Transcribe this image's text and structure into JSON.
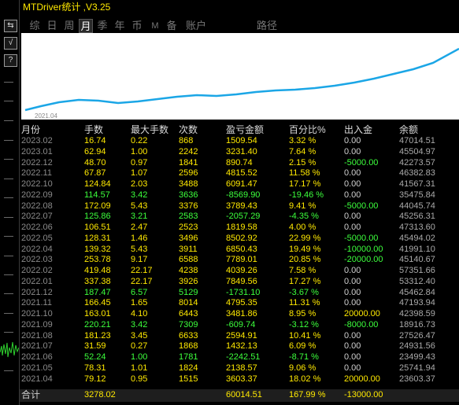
{
  "title": "MTDriver统计 ,V3.25",
  "tabs": [
    "综",
    "日",
    "周",
    "月",
    "季",
    "年",
    "币",
    "M",
    "备",
    "账户",
    "路径"
  ],
  "active_tab": "月",
  "toolbar": {
    "b1": "⇆",
    "b2": "√",
    "b3": "?"
  },
  "chart": {
    "date_label": "2021.04"
  },
  "headers": [
    "月份",
    "手数",
    "最大手数",
    "次数",
    "盈亏金额",
    "百分比%",
    "出入金",
    "余额"
  ],
  "rows": [
    {
      "c": [
        "2023.02",
        "16.74",
        "0.22",
        "868",
        "1509.54",
        "3.32 %",
        "0.00",
        "47014.51"
      ],
      "cls": [
        "dim",
        "y",
        "y",
        "y",
        "y",
        "y",
        "w",
        "m"
      ]
    },
    {
      "c": [
        "2023.01",
        "62.94",
        "1.00",
        "2242",
        "3231.40",
        "7.64 %",
        "0.00",
        "45504.97"
      ],
      "cls": [
        "dim",
        "y",
        "y",
        "y",
        "y",
        "y",
        "w",
        "m"
      ]
    },
    {
      "c": [
        "2022.12",
        "48.70",
        "0.97",
        "1841",
        "890.74",
        "2.15 %",
        "-5000.00",
        "42273.57"
      ],
      "cls": [
        "dim",
        "y",
        "y",
        "y",
        "y",
        "y",
        "g",
        "m"
      ]
    },
    {
      "c": [
        "2022.11",
        "67.87",
        "1.07",
        "2596",
        "4815.52",
        "11.58 %",
        "0.00",
        "46382.83"
      ],
      "cls": [
        "dim",
        "y",
        "y",
        "y",
        "y",
        "y",
        "w",
        "m"
      ]
    },
    {
      "c": [
        "2022.10",
        "124.84",
        "2.03",
        "3488",
        "6091.47",
        "17.17 %",
        "0.00",
        "41567.31"
      ],
      "cls": [
        "dim",
        "y",
        "y",
        "y",
        "y",
        "y",
        "w",
        "m"
      ]
    },
    {
      "c": [
        "2022.09",
        "114.57",
        "3.42",
        "3636",
        "-8569.90",
        "-19.46 %",
        "0.00",
        "35475.84"
      ],
      "cls": [
        "dim",
        "g",
        "g",
        "g",
        "g",
        "g",
        "w",
        "m"
      ]
    },
    {
      "c": [
        "2022.08",
        "172.09",
        "5.43",
        "3376",
        "3789.43",
        "9.41 %",
        "-5000.00",
        "44045.74"
      ],
      "cls": [
        "dim",
        "y",
        "y",
        "y",
        "y",
        "y",
        "g",
        "m"
      ]
    },
    {
      "c": [
        "2022.07",
        "125.86",
        "3.21",
        "2583",
        "-2057.29",
        "-4.35 %",
        "0.00",
        "45256.31"
      ],
      "cls": [
        "dim",
        "g",
        "g",
        "g",
        "g",
        "g",
        "w",
        "m"
      ]
    },
    {
      "c": [
        "2022.06",
        "106.51",
        "2.47",
        "2523",
        "1819.58",
        "4.00 %",
        "0.00",
        "47313.60"
      ],
      "cls": [
        "dim",
        "y",
        "y",
        "y",
        "y",
        "y",
        "w",
        "m"
      ]
    },
    {
      "c": [
        "2022.05",
        "128.31",
        "1.46",
        "3496",
        "8502.92",
        "22.99 %",
        "-5000.00",
        "45494.02"
      ],
      "cls": [
        "dim",
        "y",
        "y",
        "y",
        "y",
        "y",
        "g",
        "m"
      ]
    },
    {
      "c": [
        "2022.04",
        "139.32",
        "5.43",
        "3911",
        "6850.43",
        "19.49 %",
        "-10000.00",
        "41991.10"
      ],
      "cls": [
        "dim",
        "y",
        "y",
        "y",
        "y",
        "y",
        "g",
        "m"
      ]
    },
    {
      "c": [
        "2022.03",
        "253.78",
        "9.17",
        "6588",
        "7789.01",
        "20.85 %",
        "-20000.00",
        "45140.67"
      ],
      "cls": [
        "dim",
        "y",
        "y",
        "y",
        "y",
        "y",
        "g",
        "m"
      ]
    },
    {
      "c": [
        "2022.02",
        "419.48",
        "22.17",
        "4238",
        "4039.26",
        "7.58 %",
        "0.00",
        "57351.66"
      ],
      "cls": [
        "dim",
        "y",
        "y",
        "y",
        "y",
        "y",
        "w",
        "m"
      ]
    },
    {
      "c": [
        "2022.01",
        "337.38",
        "22.17",
        "3926",
        "7849.56",
        "17.27 %",
        "0.00",
        "53312.40"
      ],
      "cls": [
        "dim",
        "y",
        "y",
        "y",
        "y",
        "y",
        "w",
        "m"
      ]
    },
    {
      "c": [
        "2021.12",
        "187.47",
        "6.57",
        "5129",
        "-1731.10",
        "-3.67 %",
        "0.00",
        "45462.84"
      ],
      "cls": [
        "dim",
        "g",
        "g",
        "g",
        "g",
        "g",
        "w",
        "m"
      ]
    },
    {
      "c": [
        "2021.11",
        "166.45",
        "1.65",
        "8014",
        "4795.35",
        "11.31 %",
        "0.00",
        "47193.94"
      ],
      "cls": [
        "dim",
        "y",
        "y",
        "y",
        "y",
        "y",
        "w",
        "m"
      ]
    },
    {
      "c": [
        "2021.10",
        "163.01",
        "4.10",
        "6443",
        "3481.86",
        "8.95 %",
        "20000.00",
        "42398.59"
      ],
      "cls": [
        "dim",
        "y",
        "y",
        "y",
        "y",
        "y",
        "y",
        "m"
      ]
    },
    {
      "c": [
        "2021.09",
        "220.21",
        "3.42",
        "7309",
        "-609.74",
        "-3.12 %",
        "-8000.00",
        "18916.73"
      ],
      "cls": [
        "dim",
        "g",
        "g",
        "g",
        "g",
        "g",
        "g",
        "m"
      ]
    },
    {
      "c": [
        "2021.08",
        "181.23",
        "3.45",
        "6633",
        "2594.91",
        "10.41 %",
        "0.00",
        "27526.47"
      ],
      "cls": [
        "dim",
        "y",
        "y",
        "y",
        "y",
        "y",
        "w",
        "m"
      ]
    },
    {
      "c": [
        "2021.07",
        "31.59",
        "0.27",
        "1868",
        "1432.13",
        "6.09 %",
        "0.00",
        "24931.56"
      ],
      "cls": [
        "dim",
        "y",
        "y",
        "y",
        "y",
        "y",
        "w",
        "m"
      ]
    },
    {
      "c": [
        "2021.06",
        "52.24",
        "1.00",
        "1781",
        "-2242.51",
        "-8.71 %",
        "0.00",
        "23499.43"
      ],
      "cls": [
        "dim",
        "g",
        "g",
        "g",
        "g",
        "g",
        "w",
        "m"
      ]
    },
    {
      "c": [
        "2021.05",
        "78.31",
        "1.01",
        "1824",
        "2138.57",
        "9.06 %",
        "0.00",
        "25741.94"
      ],
      "cls": [
        "dim",
        "y",
        "y",
        "y",
        "y",
        "y",
        "w",
        "m"
      ]
    },
    {
      "c": [
        "2021.04",
        "79.12",
        "0.95",
        "1515",
        "3603.37",
        "18.02 %",
        "20000.00",
        "23603.37"
      ],
      "cls": [
        "dim",
        "y",
        "y",
        "y",
        "y",
        "y",
        "y",
        "m"
      ]
    }
  ],
  "total": {
    "label": "合计",
    "lots": "3278.02",
    "pnl": "60014.51",
    "pct": "167.99 %",
    "flow": "-13000.00"
  },
  "colors": {
    "accent": "#ffe900",
    "positive_flow": "#3cff3c",
    "line": "#1ba6e6"
  }
}
